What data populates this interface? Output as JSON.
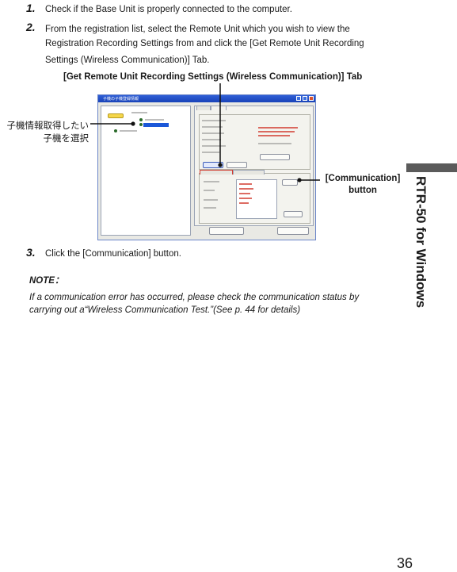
{
  "steps": [
    {
      "number": "1.",
      "lines": [
        "Check if the Base Unit is properly connected to the computer."
      ]
    },
    {
      "number": "2.",
      "lines": [
        "From the registration list, select the Remote Unit which you wish to view the",
        "Registration Recording Settings from and click the [Get Remote Unit Recording",
        "Settings (Wireless Communication)] Tab."
      ]
    },
    {
      "number": "3.",
      "lines": [
        "Click the [Communication] button."
      ]
    }
  ],
  "figure": {
    "tab_caption": "[Get Remote Unit Recording Settings (Wireless Communication)] Tab",
    "left_callout": [
      "子機情報取得したい",
      "子機を選択"
    ],
    "right_callout": [
      "[Communication]",
      "button"
    ],
    "window_title": "子機の子機登録情報"
  },
  "note": {
    "label": "NOTE：",
    "lines": [
      "If a communication error has occurred, please check the communication status by",
      "carrying out a“Wireless Communication Test.”(See p. 44 for details)"
    ]
  },
  "side_label": "RTR-50 for Windows",
  "page_number": "36",
  "colors": {
    "side_bar": "#5b5b5b",
    "title_bar": "#1842b8"
  }
}
